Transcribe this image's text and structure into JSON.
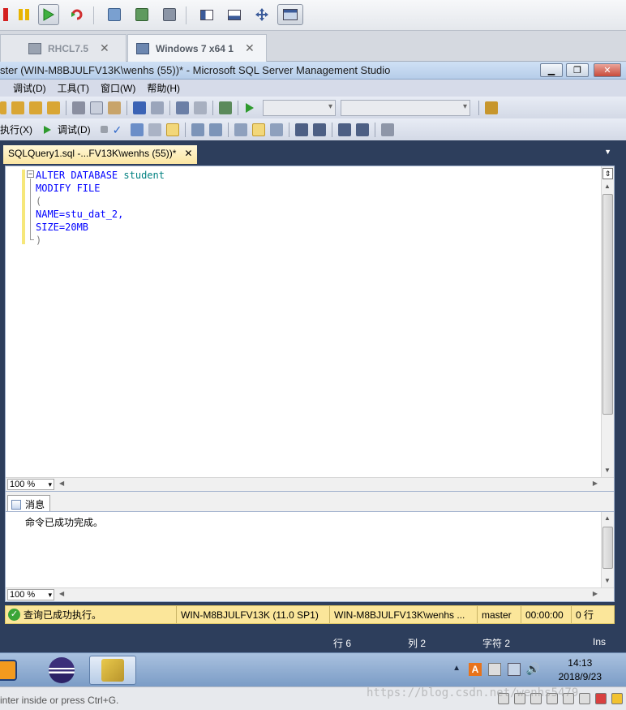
{
  "vmware": {
    "tabs": [
      {
        "label": "RHCL7.5",
        "active": false
      },
      {
        "label": "Windows 7 x64 1",
        "active": true
      }
    ],
    "footer_hint": "inter inside or press Ctrl+G."
  },
  "ssms": {
    "title": "ster (WIN-M8BJULFV13K\\wenhs (55))* - Microsoft SQL Server Management Studio",
    "menu": [
      "调试(D)",
      "工具(T)",
      "窗口(W)",
      "帮助(H)"
    ],
    "toolbar2": {
      "execute": "执行(X)",
      "debug": "调试(D)"
    },
    "document_tab": "SQLQuery1.sql -...FV13K\\wenhs (55))*",
    "code": {
      "line1_kw": "ALTER DATABASE",
      "line1_id": "student",
      "line2_kw": "MODIFY FILE",
      "line3": "(",
      "line4": "NAME=stu_dat_2,",
      "line5": "SIZE=20MB",
      "line6": ")"
    },
    "editor_zoom": "100 %",
    "results_tab": "消息",
    "results_message": "命令已成功完成。",
    "results_zoom": "100 %",
    "status": {
      "message": "查询已成功执行。",
      "server": "WIN-M8BJULFV13K (11.0 SP1)",
      "user": "WIN-M8BJULFV13K\\wenhs ...",
      "database": "master",
      "elapsed": "00:00:00",
      "rows": "0 行"
    },
    "position": {
      "line": "行 6",
      "col": "列 2",
      "char": "字符 2",
      "mode": "Ins"
    }
  },
  "taskbar": {
    "time": "14:13",
    "date": "2018/9/23"
  },
  "watermark": "https://blog.csdn.net/wenhs5479"
}
